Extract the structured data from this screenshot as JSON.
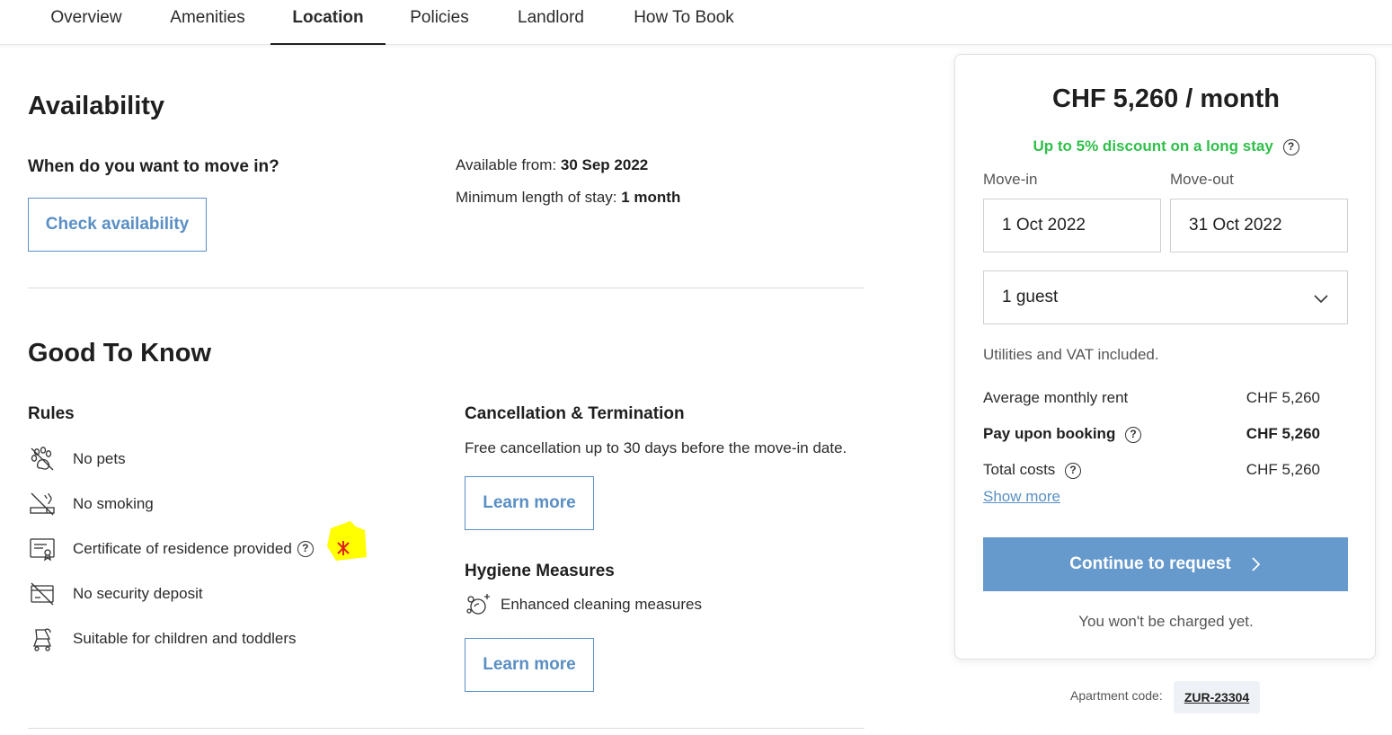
{
  "nav": {
    "tabs": [
      {
        "label": "Overview"
      },
      {
        "label": "Amenities"
      },
      {
        "label": "Location",
        "active": true
      },
      {
        "label": "Policies"
      },
      {
        "label": "Landlord"
      },
      {
        "label": "How To Book"
      }
    ]
  },
  "availability": {
    "title": "Availability",
    "question": "When do you want to move in?",
    "check_button": "Check availability",
    "available_from_label": "Available from:",
    "available_from_value": "30 Sep 2022",
    "min_stay_label": "Minimum length of stay:",
    "min_stay_value": "1 month"
  },
  "good_to_know": {
    "title": "Good To Know",
    "rules_title": "Rules",
    "rules": [
      {
        "label": "No pets",
        "icon": "no-pets-icon"
      },
      {
        "label": "No smoking",
        "icon": "no-smoking-icon"
      },
      {
        "label": "Certificate of residence provided",
        "icon": "certificate-icon"
      },
      {
        "label": "No security deposit",
        "icon": "no-deposit-icon"
      },
      {
        "label": "Suitable for children and toddlers",
        "icon": "stroller-icon"
      }
    ],
    "cancellation_title": "Cancellation & Termination",
    "cancellation_text": "Free cancellation up to 30 days before the move-in date.",
    "learn_more_1": "Learn more",
    "hygiene_title": "Hygiene Measures",
    "hygiene_item": "Enhanced cleaning measures",
    "learn_more_2": "Learn more",
    "help_glyph": "?"
  },
  "booking": {
    "price": "CHF 5,260 / month",
    "discount": "Up to 5% discount on a long stay",
    "move_in_label": "Move-in",
    "move_in_value": "1 Oct 2022",
    "move_out_label": "Move-out",
    "move_out_value": "31 Oct 2022",
    "guests_value": "1 guest",
    "utilities_note": "Utilities and VAT included.",
    "rows": [
      {
        "label": "Average monthly rent",
        "value": "CHF 5,260"
      },
      {
        "label": "Pay upon booking",
        "value": "CHF 5,260"
      },
      {
        "label": "Total costs",
        "value": "CHF 5,260"
      }
    ],
    "show_more": "Show more",
    "cta": "Continue to request",
    "charge_note": "You won't be charged yet.",
    "accent_color": "#6699cc",
    "discount_color": "#2fbf4a"
  },
  "apartment": {
    "code_label": "Apartment code:",
    "code_value": "ZUR-23304"
  }
}
